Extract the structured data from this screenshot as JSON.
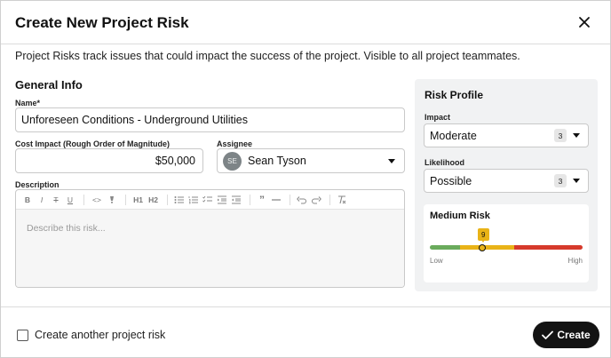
{
  "modal": {
    "title": "Create New Project Risk",
    "close_icon": "close-icon",
    "intro": "Project Risks track issues that could impact the success of the project. Visible to all project teammates."
  },
  "general": {
    "section_title": "General Info",
    "name_label": "Name*",
    "name_value": "Unforeseen Conditions - Underground Utilities",
    "cost_label": "Cost Impact (Rough Order of Magnitude)",
    "cost_value": "$50,000",
    "assignee_label": "Assignee",
    "assignee_initials": "SE",
    "assignee_name": "Sean Tyson",
    "description_label": "Description",
    "description_placeholder": "Describe this risk...",
    "toolbar": [
      {
        "label": "B",
        "icon": "bold-icon"
      },
      {
        "label": "I",
        "icon": "italic-icon"
      },
      {
        "label": "T",
        "icon": "strikethrough-icon"
      },
      {
        "label": "U",
        "icon": "underline-icon"
      },
      {
        "label": "<>",
        "icon": "code-icon"
      },
      {
        "label": "H1",
        "icon": "heading1-icon"
      },
      {
        "label": "H2",
        "icon": "heading2-icon"
      },
      {
        "label": "”",
        "icon": "quote-icon"
      }
    ]
  },
  "profile": {
    "title": "Risk Profile",
    "impact_label": "Impact",
    "impact_value": "Moderate",
    "impact_score": "3",
    "likelihood_label": "Likelihood",
    "likelihood_value": "Possible",
    "likelihood_score": "3",
    "risk_title": "Medium Risk",
    "risk_score": "9",
    "risk_level_fraction": 0.35,
    "low_label": "Low",
    "high_label": "High",
    "colors": {
      "low": "#6aab5c",
      "medium": "#e9b317",
      "high": "#d63a2b"
    }
  },
  "footer": {
    "checkbox_label": "Create another project risk",
    "checkbox_checked": false,
    "create_label": "Create",
    "create_icon": "check-icon"
  }
}
